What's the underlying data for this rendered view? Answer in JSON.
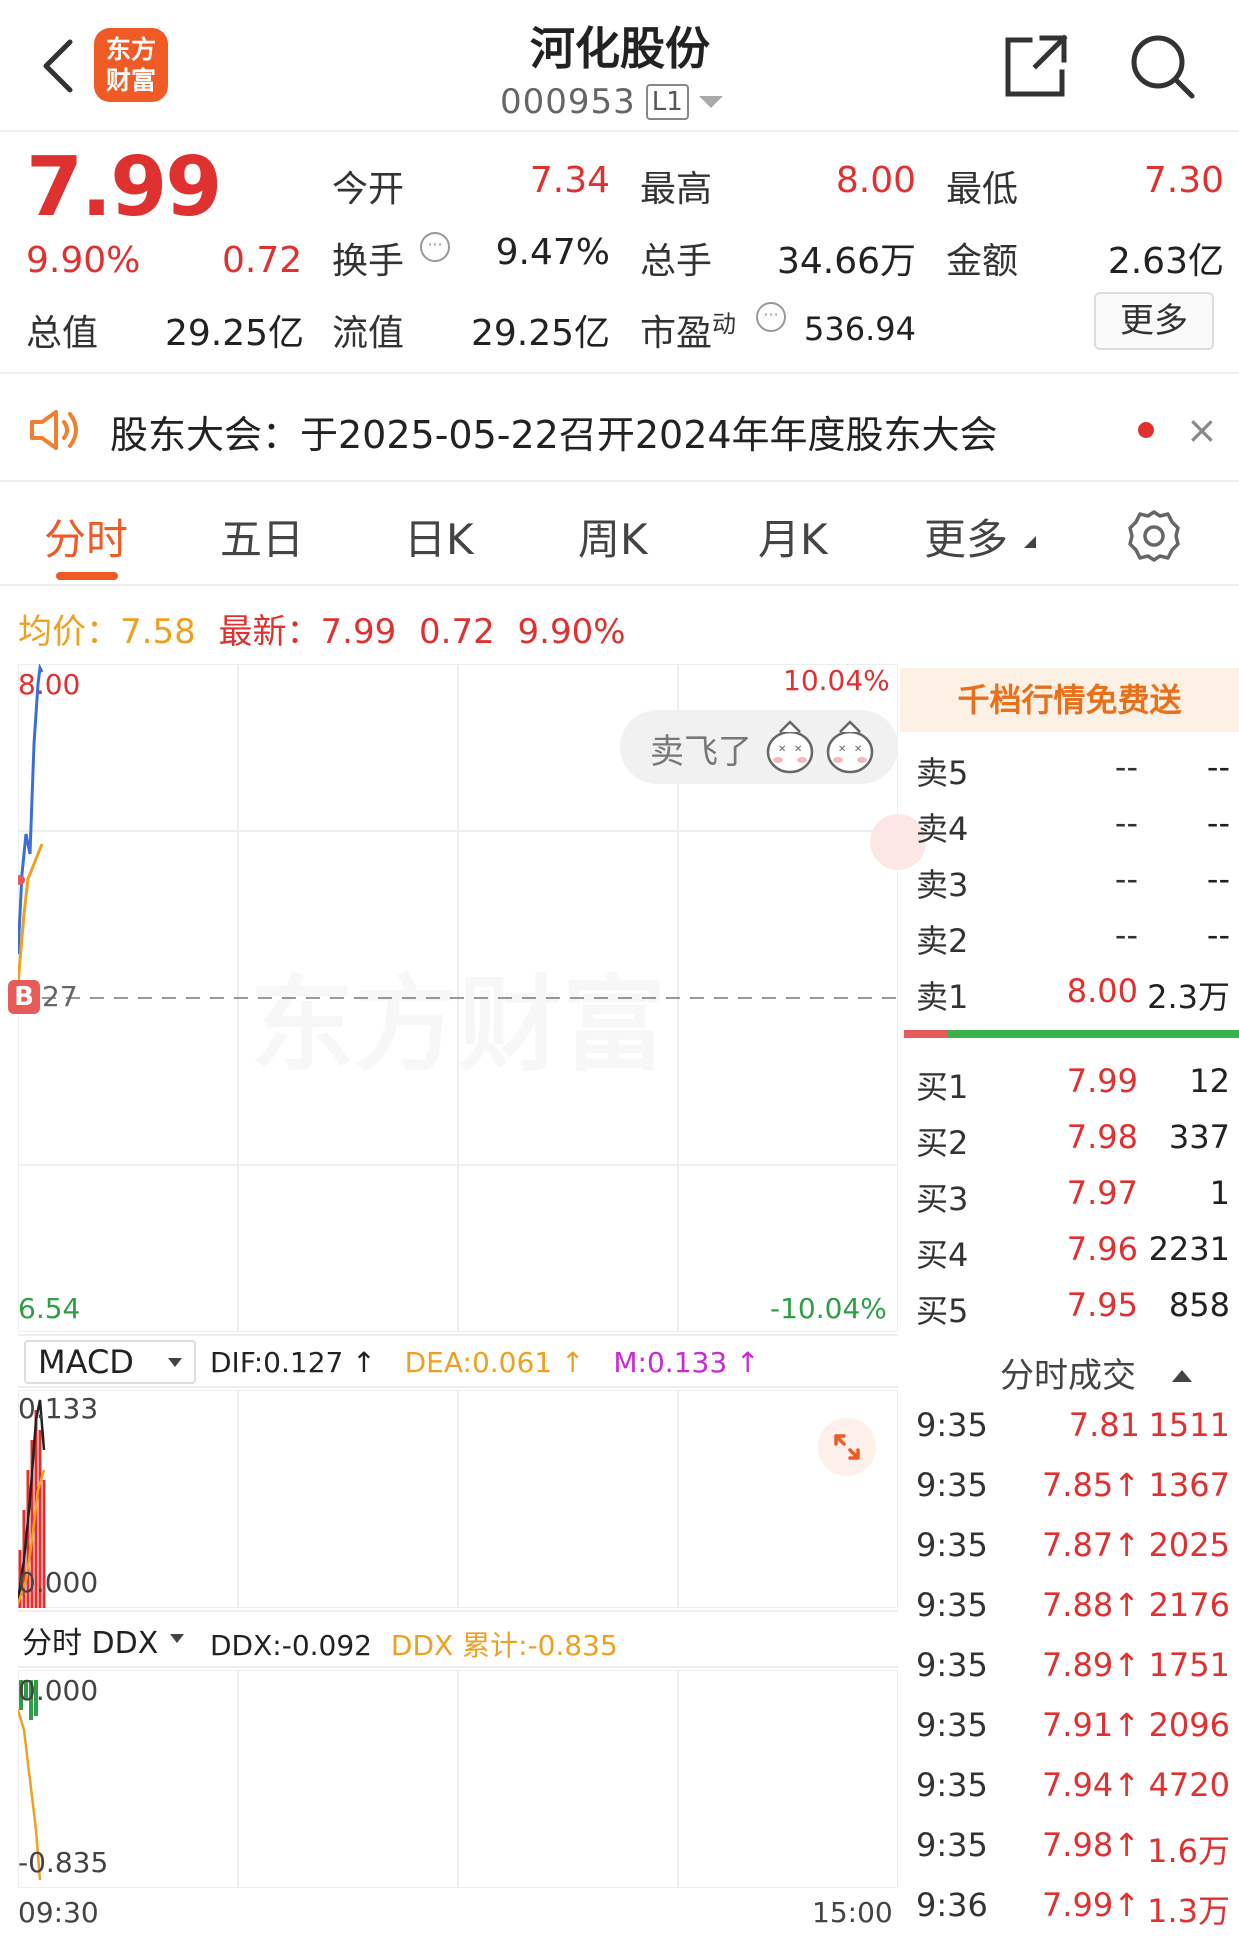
{
  "header": {
    "logo_line1": "东方",
    "logo_line2": "财富",
    "title": "河化股份",
    "code": "000953",
    "level": "L1"
  },
  "quote": {
    "price": "7.99",
    "change_pct": "9.90%",
    "change": "0.72",
    "open_label": "今开",
    "open": "7.34",
    "high_label": "最高",
    "high": "8.00",
    "low_label": "最低",
    "low": "7.30",
    "turnover_label": "换手",
    "turnover": "9.47%",
    "volume_label": "总手",
    "volume": "34.66万",
    "amount_label": "金额",
    "amount": "2.63亿",
    "mktcap_label": "总值",
    "mktcap": "29.25亿",
    "float_label": "流值",
    "float": "29.25亿",
    "pe_label": "市盈",
    "pe_sup": "动",
    "pe": "536.94",
    "more": "更多"
  },
  "notice": {
    "text": "股东大会：于2025-05-22召开2024年年度股东大会",
    "close": "×"
  },
  "tabs": [
    "分时",
    "五日",
    "日K",
    "周K",
    "月K",
    "更多"
  ],
  "avg": {
    "avg_label": "均价：",
    "avg": "7.58",
    "latest_label": "最新：",
    "latest": "7.99",
    "chg": "0.72",
    "pct": "9.90%"
  },
  "chart": {
    "top_price": "8.00",
    "bottom_price": "6.54",
    "top_pct": "10.04%",
    "bottom_pct": "-10.04%",
    "ref_label": "27",
    "b_mark": "B",
    "watermark": "东方财富",
    "bubble": "卖飞了",
    "time_start": "09:30",
    "time_end": "15:00"
  },
  "orderbook": {
    "header": "千档行情免费送",
    "asks": [
      {
        "label": "卖5",
        "price": "--",
        "vol": "--"
      },
      {
        "label": "卖4",
        "price": "--",
        "vol": "--"
      },
      {
        "label": "卖3",
        "price": "--",
        "vol": "--"
      },
      {
        "label": "卖2",
        "price": "--",
        "vol": "--"
      },
      {
        "label": "卖1",
        "price": "8.00",
        "vol": "2.3万"
      }
    ],
    "bids": [
      {
        "label": "买1",
        "price": "7.99",
        "vol": "12"
      },
      {
        "label": "买2",
        "price": "7.98",
        "vol": "337"
      },
      {
        "label": "买3",
        "price": "7.97",
        "vol": "1"
      },
      {
        "label": "买4",
        "price": "7.96",
        "vol": "2231"
      },
      {
        "label": "买5",
        "price": "7.95",
        "vol": "858"
      }
    ]
  },
  "trades": {
    "title": "分时成交",
    "rows": [
      {
        "time": "9:35",
        "price": "7.81",
        "vol": "1511"
      },
      {
        "time": "9:35",
        "price": "7.85↑",
        "vol": "1367"
      },
      {
        "time": "9:35",
        "price": "7.87↑",
        "vol": "2025"
      },
      {
        "time": "9:35",
        "price": "7.88↑",
        "vol": "2176"
      },
      {
        "time": "9:35",
        "price": "7.89↑",
        "vol": "1751"
      },
      {
        "time": "9:35",
        "price": "7.91↑",
        "vol": "2096"
      },
      {
        "time": "9:35",
        "price": "7.94↑",
        "vol": "4720"
      },
      {
        "time": "9:35",
        "price": "7.98↑",
        "vol": "1.6万"
      },
      {
        "time": "9:36",
        "price": "7.99↑",
        "vol": "1.3万"
      }
    ]
  },
  "macd": {
    "selector": "MACD",
    "dif": "DIF:0.127 ↑",
    "dea": "DEA:0.061 ↑",
    "m": "M:0.133 ↑",
    "top": "0.133",
    "bottom": "0.000"
  },
  "ddx": {
    "selector": "分时 DDX",
    "ddx": "DDX:-0.092",
    "ddx_cum": "DDX 累计:-0.835",
    "top": "0.000",
    "bottom": "-0.835"
  },
  "colors": {
    "up": "#e03131",
    "down": "#2f9e44",
    "accent": "#f05a24",
    "avg_line": "#f0a020"
  }
}
